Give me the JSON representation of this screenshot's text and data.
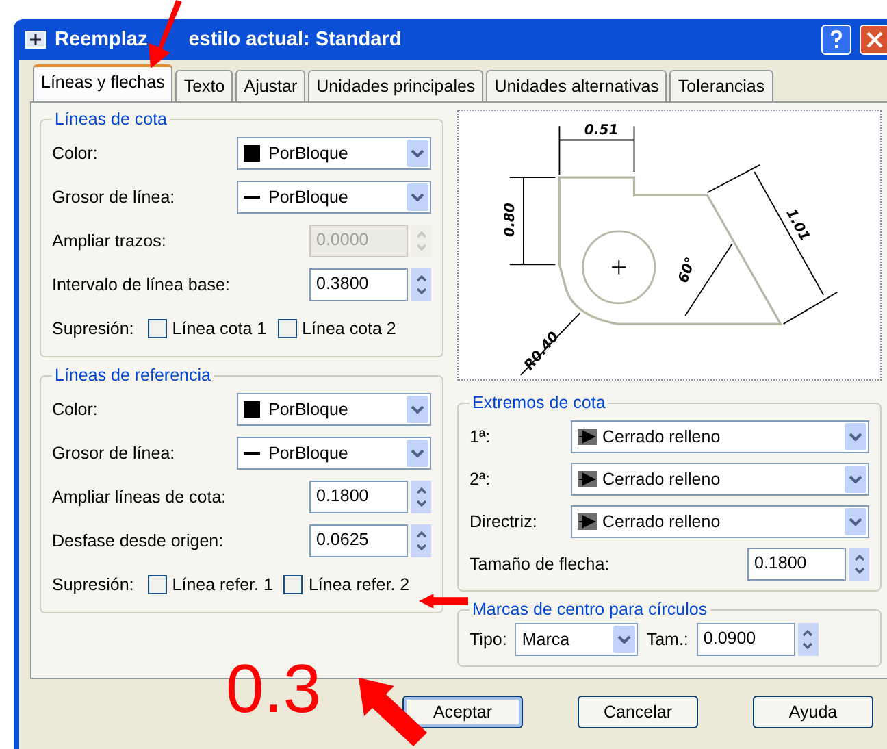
{
  "window": {
    "title_fragments": [
      "Reemplaz",
      "estilo actual: Standard"
    ]
  },
  "tabs": [
    {
      "label": "Líneas y flechas",
      "selected": true
    },
    {
      "label": "Texto",
      "selected": false
    },
    {
      "label": "Ajustar",
      "selected": false
    },
    {
      "label": "Unidades principales",
      "selected": false
    },
    {
      "label": "Unidades alternativas",
      "selected": false
    },
    {
      "label": "Tolerancias",
      "selected": false
    }
  ],
  "dimension_lines": {
    "legend": "Líneas de cota",
    "fields": [
      {
        "kind": "color",
        "label": "Color:",
        "value": "PorBloque"
      },
      {
        "kind": "lineweight",
        "label": "Grosor de línea:",
        "value": "PorBloque"
      },
      {
        "kind": "spin",
        "label": "Ampliar trazos:",
        "value": "0.0000",
        "disabled": true
      },
      {
        "kind": "spin",
        "label": "Intervalo de línea base:",
        "value": "0.3800",
        "disabled": false
      },
      {
        "kind": "checks",
        "label": "Supresión:",
        "options": [
          {
            "label": "Línea cota 1",
            "checked": false
          },
          {
            "label": "Línea cota 2",
            "checked": false
          }
        ]
      }
    ]
  },
  "extension_lines": {
    "legend": "Líneas de referencia",
    "fields": [
      {
        "kind": "color",
        "label": "Color:",
        "value": "PorBloque"
      },
      {
        "kind": "lineweight",
        "label": "Grosor de línea:",
        "value": "PorBloque"
      },
      {
        "kind": "spin",
        "label": "Ampliar líneas de cota:",
        "value": "0.1800",
        "disabled": false
      },
      {
        "kind": "spin",
        "label": "Desfase desde origen:",
        "value": "0.0625",
        "disabled": false
      },
      {
        "kind": "checks",
        "label": "Supresión:",
        "options": [
          {
            "label": "Línea refer. 1",
            "checked": false
          },
          {
            "label": "Línea refer. 2",
            "checked": false
          }
        ]
      }
    ]
  },
  "preview": {
    "labels": [
      "0.51",
      "0.80",
      "1.01",
      "60°",
      "R0.40"
    ]
  },
  "arrowheads": {
    "legend": "Extremos de cota",
    "fields": [
      {
        "kind": "arrow",
        "label": "1ª:",
        "value": "Cerrado relleno"
      },
      {
        "kind": "arrow",
        "label": "2ª:",
        "value": "Cerrado relleno"
      },
      {
        "kind": "arrow",
        "label": "Directriz:",
        "value": "Cerrado relleno"
      },
      {
        "kind": "spin",
        "label": "Tamaño de flecha:",
        "value": "0.1800",
        "disabled": false
      }
    ]
  },
  "center_marks": {
    "legend": "Marcas de centro para círculos",
    "type_label": "Tipo:",
    "type_value": "Marca",
    "size_label": "Tam.:",
    "size_value": "0.0900"
  },
  "buttons": [
    {
      "label": "Aceptar",
      "default": true
    },
    {
      "label": "Cancelar",
      "default": false
    },
    {
      "label": "Ayuda",
      "default": false
    }
  ],
  "annotation": {
    "text": "0.3"
  }
}
